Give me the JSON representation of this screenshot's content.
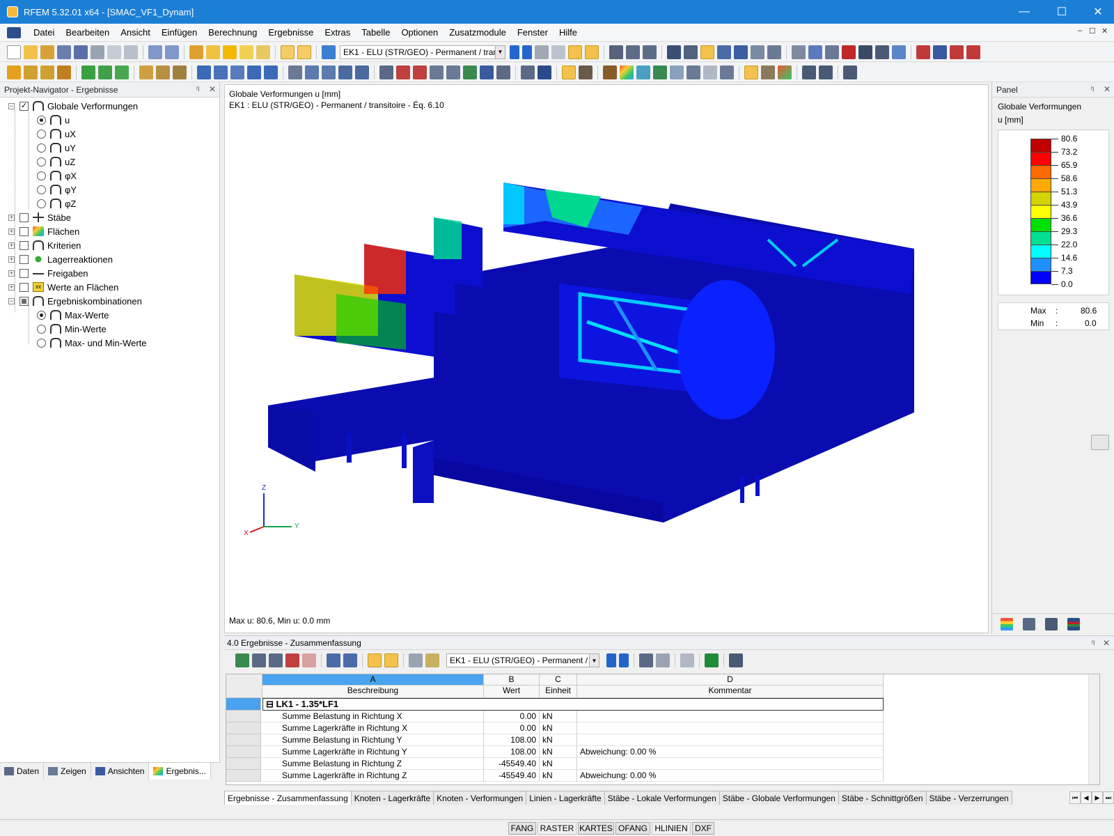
{
  "window": {
    "title": "RFEM 5.32.01 x64 - [SMAC_VF1_Dynam]",
    "controls": [
      "—",
      "☐",
      "✕"
    ]
  },
  "menu": [
    "Datei",
    "Bearbeiten",
    "Ansicht",
    "Einfügen",
    "Berechnung",
    "Ergebnisse",
    "Extras",
    "Tabelle",
    "Optionen",
    "Zusatzmodule",
    "Fenster",
    "Hilfe"
  ],
  "mdi_controls": [
    "–",
    "☐",
    "✕"
  ],
  "toolbar": {
    "loadcase_combo": "EK1 - ELU (STR/GEO) - Permanent / trar"
  },
  "navigator": {
    "title": "Projekt-Navigator - Ergebnisse",
    "pin": "ᵑ",
    "close": "✕",
    "items": [
      {
        "label": "Globale Verformungen"
      },
      {
        "label": "u"
      },
      {
        "label": "uX"
      },
      {
        "label": "uY"
      },
      {
        "label": "uZ"
      },
      {
        "label": "φX"
      },
      {
        "label": "φY"
      },
      {
        "label": "φZ"
      },
      {
        "label": "Stäbe"
      },
      {
        "label": "Flächen"
      },
      {
        "label": "Kriterien"
      },
      {
        "label": "Lagerreaktionen"
      },
      {
        "label": "Freigaben"
      },
      {
        "label": "Werte an Flächen"
      },
      {
        "label": "Ergebniskombinationen"
      },
      {
        "label": "Max-Werte"
      },
      {
        "label": "Min-Werte"
      },
      {
        "label": "Max- und Min-Werte"
      }
    ],
    "werte_icon_text": "xx",
    "tabs": [
      "Daten",
      "Zeigen",
      "Ansichten",
      "Ergebnis..."
    ]
  },
  "viewport": {
    "line1": "Globale Verformungen u [mm]",
    "line2": "EK1 : ELU (STR/GEO) - Permanent / transitoire - Éq. 6.10",
    "footer": "Max u: 80.6, Min u: 0.0 mm",
    "axes": {
      "z": "Z",
      "y": "Y",
      "x": "X"
    }
  },
  "panel": {
    "title": "Panel",
    "heading": "Globale Verformungen",
    "unit": "u [mm]",
    "legend": [
      {
        "value": "80.6",
        "color": "#c00000"
      },
      {
        "value": "73.2",
        "color": "#ff0000"
      },
      {
        "value": "65.9",
        "color": "#ff6a00"
      },
      {
        "value": "58.6",
        "color": "#ffaa00"
      },
      {
        "value": "51.3",
        "color": "#d4d400"
      },
      {
        "value": "43.9",
        "color": "#ffff00"
      },
      {
        "value": "36.6",
        "color": "#00e000"
      },
      {
        "value": "29.3",
        "color": "#00e090"
      },
      {
        "value": "22.0",
        "color": "#00ffff"
      },
      {
        "value": "14.6",
        "color": "#1e90ff"
      },
      {
        "value": "7.3",
        "color": "#0000ff"
      },
      {
        "value": "0.0",
        "color": "#0000a0"
      }
    ],
    "max_label": "Max",
    "max_value": "80.6",
    "min_label": "Min",
    "min_value": "0.0",
    "sep": ":"
  },
  "results": {
    "title": "4.0 Ergebnisse - Zusammenfassung",
    "combo": "EK1 - ELU (STR/GEO) - Permanent /",
    "columns": [
      {
        "letter": "A",
        "label": "Beschreibung"
      },
      {
        "letter": "B",
        "label": "Wert"
      },
      {
        "letter": "C",
        "label": "Einheit"
      },
      {
        "letter": "D",
        "label": "Kommentar"
      }
    ],
    "group": "LK1 - 1.35*LF1",
    "group_toggle": "⊟",
    "rows": [
      {
        "desc": "Summe Belastung in Richtung X",
        "value": "0.00",
        "unit": "kN",
        "comment": ""
      },
      {
        "desc": "Summe Lagerkräfte in Richtung X",
        "value": "0.00",
        "unit": "kN",
        "comment": ""
      },
      {
        "desc": "Summe Belastung in Richtung Y",
        "value": "108.00",
        "unit": "kN",
        "comment": ""
      },
      {
        "desc": "Summe Lagerkräfte in Richtung Y",
        "value": "108.00",
        "unit": "kN",
        "comment": "Abweichung:  0.00 %"
      },
      {
        "desc": "Summe Belastung in Richtung Z",
        "value": "-45549.40",
        "unit": "kN",
        "comment": ""
      },
      {
        "desc": "Summe Lagerkräfte in Richtung Z",
        "value": "-45549.40",
        "unit": "kN",
        "comment": "Abweichung:  0.00 %"
      }
    ],
    "tabs": [
      "Ergebnisse - Zusammenfassung",
      "Knoten - Lagerkräfte",
      "Knoten - Verformungen",
      "Linien - Lagerkräfte",
      "Stäbe - Lokale Verformungen",
      "Stäbe - Globale Verformungen",
      "Stäbe - Schnittgrößen",
      "Stäbe - Verzerrungen"
    ],
    "tab_nav": [
      "⏮",
      "◀",
      "▶",
      "⏭"
    ]
  },
  "statusbar": [
    "FANG",
    "RASTER",
    "KARTES",
    "OFANG",
    "HLINIEN",
    "DXF"
  ]
}
